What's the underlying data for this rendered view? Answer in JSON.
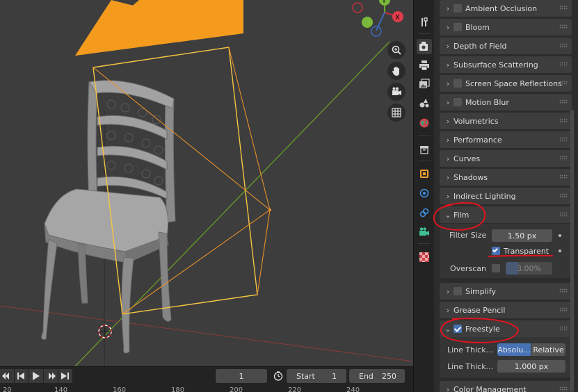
{
  "viewport": {
    "gizmo": {
      "y_axis_label": "Y"
    }
  },
  "timeline": {
    "current_frame": "1",
    "start_label": "Start",
    "start_value": "1",
    "end_label": "End",
    "end_value": "250",
    "ruler_ticks": [
      "20",
      "140",
      "160",
      "180",
      "200",
      "220",
      "240"
    ]
  },
  "tabs": [
    {
      "name": "tool-tab",
      "icon": "wrench-screwdriver-icon",
      "active": false
    },
    {
      "name": "render-tab",
      "icon": "camera-back-icon",
      "active": true
    },
    {
      "name": "output-tab",
      "icon": "printer-icon",
      "active": false
    },
    {
      "name": "view-layer-tab",
      "icon": "image-stack-icon",
      "active": false
    },
    {
      "name": "scene-tab",
      "icon": "shapes-icon",
      "active": false
    },
    {
      "name": "world-tab",
      "icon": "globe-icon",
      "active": false
    },
    {
      "name": "collection-tab",
      "icon": "box-icon",
      "active": false
    },
    {
      "name": "object-tab",
      "icon": "orange-square-icon",
      "active": false
    },
    {
      "name": "physics-tab",
      "icon": "orbit-icon",
      "active": false
    },
    {
      "name": "constraints-tab",
      "icon": "link-icon",
      "active": false
    },
    {
      "name": "data-tab",
      "icon": "camera-data-icon",
      "active": false
    },
    {
      "name": "texture-tab",
      "icon": "checker-icon",
      "active": false
    }
  ],
  "properties": {
    "panels": [
      {
        "key": "ambient_occlusion",
        "label": "Ambient Occlusion",
        "checkbox": true,
        "checked": false,
        "expanded": false
      },
      {
        "key": "bloom",
        "label": "Bloom",
        "checkbox": true,
        "checked": false,
        "expanded": false
      },
      {
        "key": "depth_of_field",
        "label": "Depth of Field",
        "checkbox": false,
        "expanded": false
      },
      {
        "key": "subsurface",
        "label": "Subsurface Scattering",
        "checkbox": false,
        "expanded": false
      },
      {
        "key": "ssr",
        "label": "Screen Space Reflections",
        "checkbox": true,
        "checked": false,
        "expanded": false
      },
      {
        "key": "motion_blur",
        "label": "Motion Blur",
        "checkbox": true,
        "checked": false,
        "expanded": false
      },
      {
        "key": "volumetrics",
        "label": "Volumetrics",
        "checkbox": false,
        "expanded": false
      },
      {
        "key": "performance",
        "label": "Performance",
        "checkbox": false,
        "expanded": false
      },
      {
        "key": "curves",
        "label": "Curves",
        "checkbox": false,
        "expanded": false
      },
      {
        "key": "shadows",
        "label": "Shadows",
        "checkbox": false,
        "expanded": false
      },
      {
        "key": "indirect_lighting",
        "label": "Indirect Lighting",
        "checkbox": false,
        "expanded": false
      },
      {
        "key": "film",
        "label": "Film",
        "checkbox": false,
        "expanded": true
      },
      {
        "key": "simplify",
        "label": "Simplify",
        "checkbox": true,
        "checked": false,
        "expanded": false
      },
      {
        "key": "grease_pencil",
        "label": "Grease Pencil",
        "checkbox": false,
        "expanded": false
      },
      {
        "key": "freestyle",
        "label": "Freestyle",
        "checkbox": true,
        "checked": true,
        "expanded": true
      },
      {
        "key": "color_management",
        "label": "Color Management",
        "checkbox": false,
        "expanded": false
      }
    ],
    "film": {
      "filter_size_label": "Filter Size",
      "filter_size_value": "1.50 px",
      "transparent_label": "Transparent",
      "transparent_checked": true,
      "overscan_label": "Overscan",
      "overscan_checked": false,
      "overscan_value": "3.00%"
    },
    "freestyle": {
      "line_thickness_mode_label": "Line Thick...",
      "mode_absolute": "Absolu...",
      "mode_relative": "Relative",
      "mode_selected": "absolute",
      "line_thickness_label": "Line Thick...",
      "line_thickness_value": "1.000 px"
    }
  },
  "colors": {
    "annotation_red": "#e0141e",
    "camera_frame": "#f5c542",
    "camera_lines": "#e8902a",
    "light_cone": "#f49b1e",
    "accent_blue": "#4772b3"
  }
}
